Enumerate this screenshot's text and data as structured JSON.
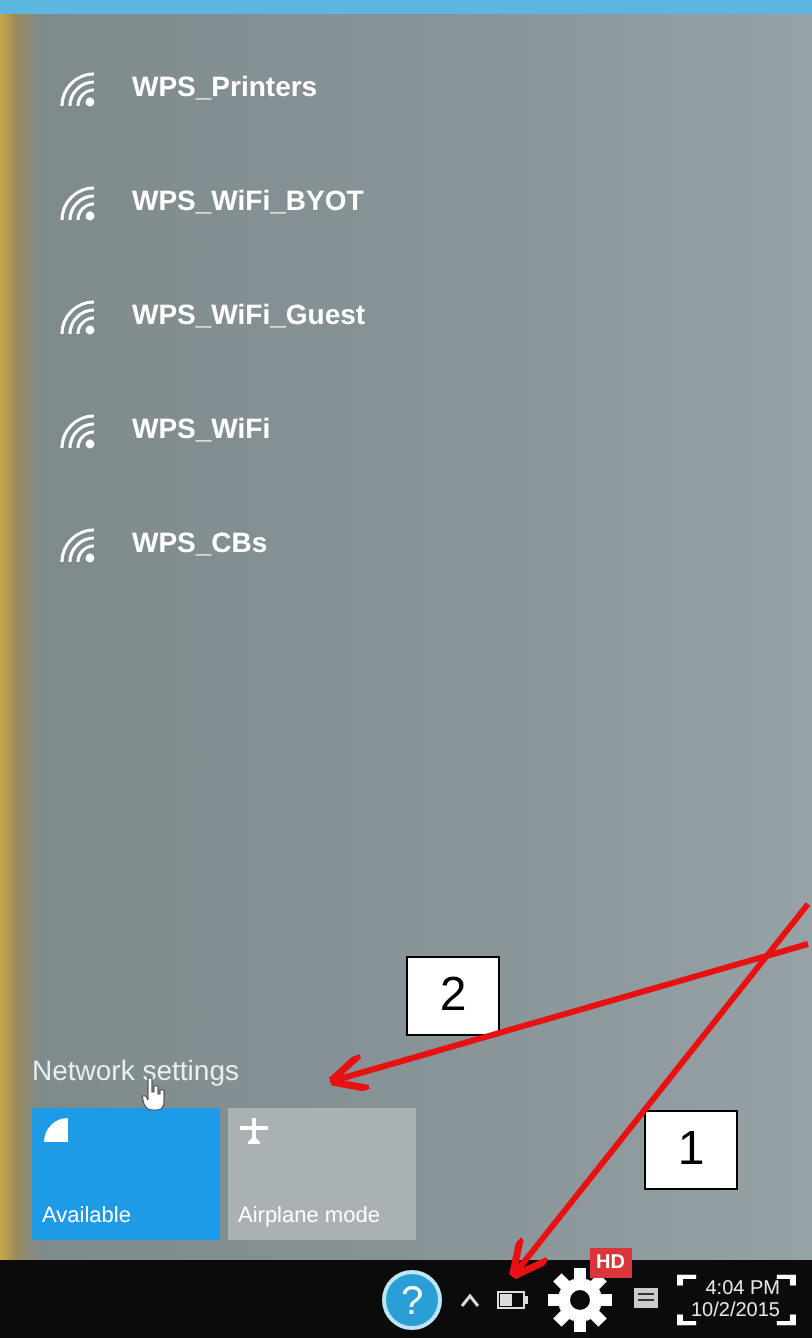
{
  "networks": [
    {
      "name": "WPS_Printers"
    },
    {
      "name": "WPS_WiFi_BYOT"
    },
    {
      "name": "WPS_WiFi_Guest"
    },
    {
      "name": "WPS_WiFi"
    },
    {
      "name": "WPS_CBs"
    }
  ],
  "network_settings_link": "Network settings",
  "quick_actions": [
    {
      "kind": "wifi",
      "label": "Available",
      "selected": true
    },
    {
      "kind": "airplane",
      "label": "Airplane mode",
      "selected": false
    }
  ],
  "callouts": [
    {
      "label": "2"
    },
    {
      "label": "1"
    }
  ],
  "taskbar": {
    "help_glyph": "?",
    "badge": "HD",
    "time": "4:04 PM",
    "date": "10/2/2015"
  }
}
